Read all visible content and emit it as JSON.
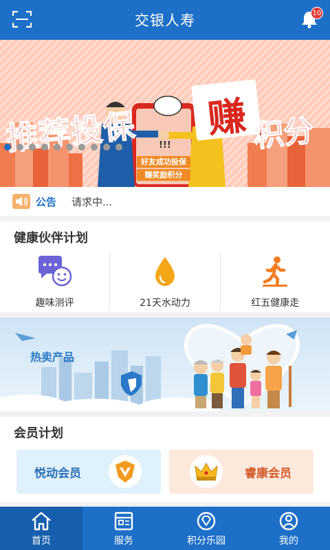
{
  "header": {
    "title": "交银人寿",
    "notification_count": "10"
  },
  "banner": {
    "promo_main": "推荐投保",
    "promo_earn": "赚",
    "promo_points": "积分",
    "bubble": "!!!",
    "phone_caption_1": "好友成功投保",
    "phone_caption_2": "赚奖励积分",
    "slide_count": 10,
    "active_slide": 0
  },
  "notice": {
    "label": "公告",
    "text": "请求中..."
  },
  "health_plan": {
    "title": "健康伙伴计划",
    "items": [
      {
        "label": "趣味测评",
        "icon": "chat-smile-icon"
      },
      {
        "label": "21天水动力",
        "icon": "water-drop-icon"
      },
      {
        "label": "红五健康走",
        "icon": "walking-icon"
      }
    ]
  },
  "hot_products": {
    "title": "热卖产品"
  },
  "member_plan": {
    "title": "会员计划",
    "cards": [
      {
        "label": "悦动会员",
        "icon": "v-badge-icon"
      },
      {
        "label": "睿康会员",
        "icon": "crown-icon"
      }
    ]
  },
  "tabs": [
    {
      "label": "首页",
      "icon": "home-icon",
      "active": true
    },
    {
      "label": "服务",
      "icon": "service-icon",
      "active": false
    },
    {
      "label": "积分乐园",
      "icon": "points-icon",
      "active": false
    },
    {
      "label": "我的",
      "icon": "profile-icon",
      "active": false
    }
  ],
  "colors": {
    "primary": "#1d6fc8",
    "accent_red": "#d9281f",
    "orange": "#f08a24"
  }
}
